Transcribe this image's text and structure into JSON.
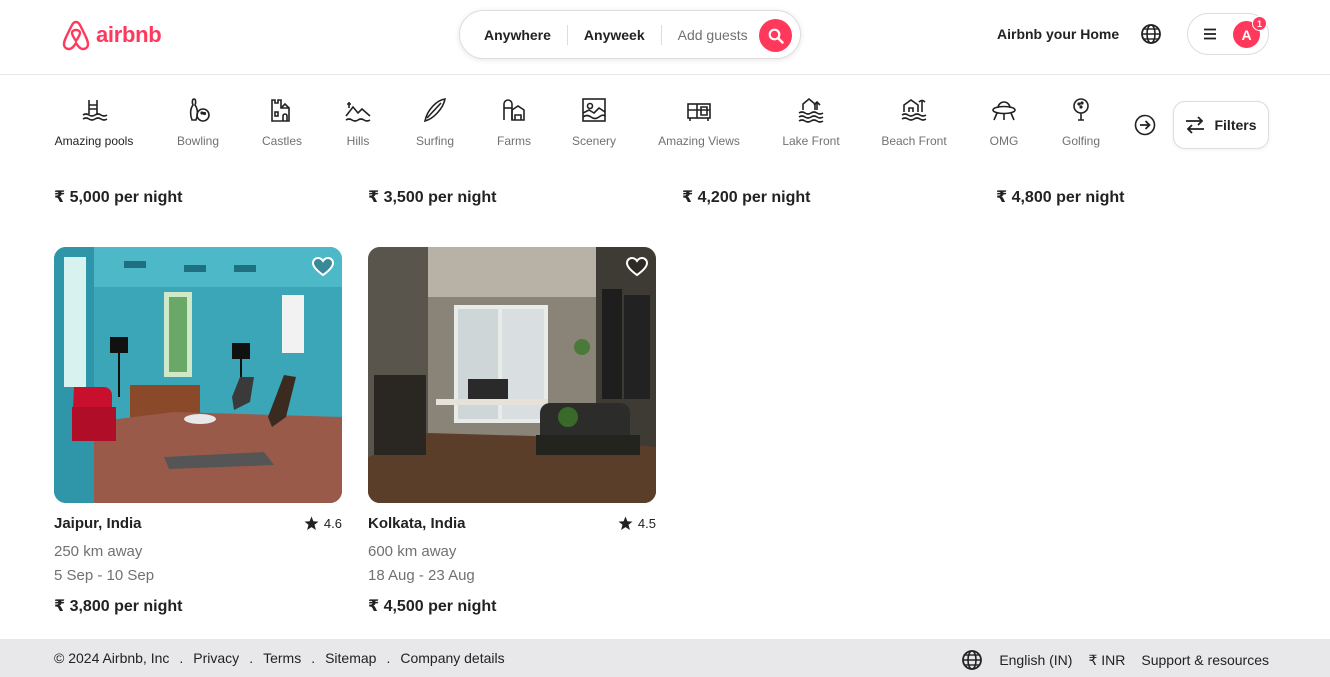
{
  "brand": {
    "name": "airbnb",
    "color": "#ff385c",
    "icon": "airbnb-logo-icon"
  },
  "search": {
    "where": "Anywhere",
    "when": "Anyweek",
    "who": "Add guests"
  },
  "header": {
    "host_link": "Airbnb your Home",
    "avatar_letter": "A",
    "notification_count": "1"
  },
  "categories": [
    {
      "label": "Amazing pools",
      "icon": "pool-icon"
    },
    {
      "label": "Bowling",
      "icon": "bowling-icon"
    },
    {
      "label": "Castles",
      "icon": "castle-icon"
    },
    {
      "label": "Hills",
      "icon": "hills-icon"
    },
    {
      "label": "Surfing",
      "icon": "surfboard-icon"
    },
    {
      "label": "Farms",
      "icon": "farm-icon"
    },
    {
      "label": "Scenery",
      "icon": "scenery-icon"
    },
    {
      "label": "Amazing Views",
      "icon": "views-icon"
    },
    {
      "label": "Lake Front",
      "icon": "lake-icon"
    },
    {
      "label": "Beach Front",
      "icon": "beach-icon"
    },
    {
      "label": "OMG",
      "icon": "ufo-icon"
    },
    {
      "label": "Golfing",
      "icon": "golf-icon"
    }
  ],
  "filters_label": "Filters",
  "previous_row_prices": [
    "₹ 5,000 per night",
    "₹ 3,500 per night",
    "₹ 4,200 per night",
    "₹ 4,800 per night"
  ],
  "listings": [
    {
      "location": "Jaipur, India",
      "rating": "4.6",
      "distance": "250 km away",
      "dates": "5 Sep - 10 Sep",
      "price": "₹ 3,800 per night"
    },
    {
      "location": "Kolkata, India",
      "rating": "4.5",
      "distance": "600 km away",
      "dates": "18 Aug - 23 Aug",
      "price": "₹ 4,500 per night"
    }
  ],
  "footer": {
    "copyright": "© 2024 Airbnb, Inc",
    "links": [
      "Privacy",
      "Terms",
      "Sitemap",
      "Company details"
    ],
    "language": "English (IN)",
    "currency": "₹ INR",
    "support": "Support & resources"
  }
}
